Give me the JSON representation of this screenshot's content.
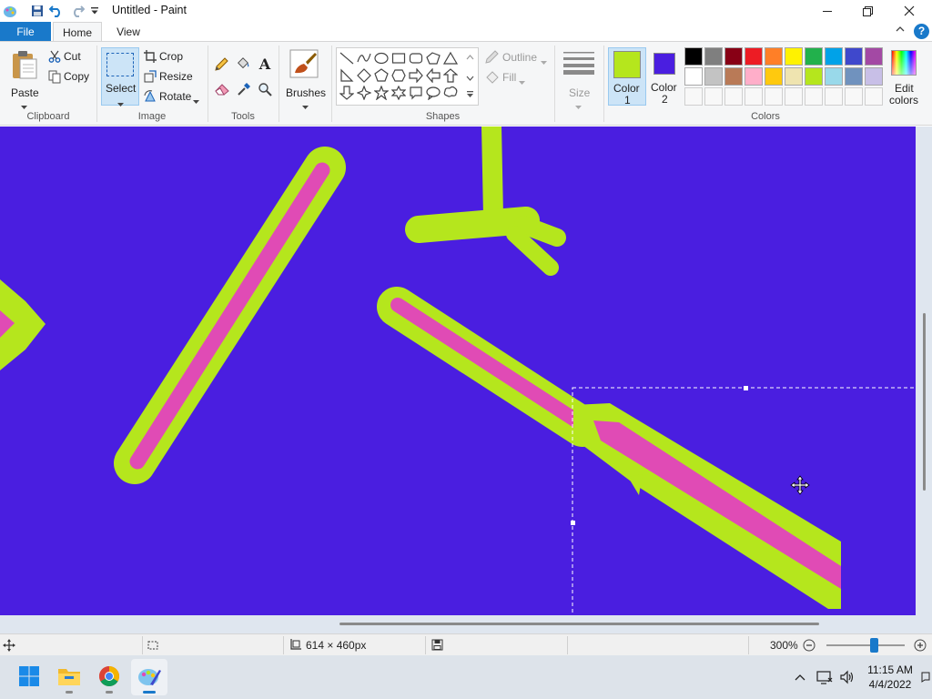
{
  "window": {
    "title": "Untitled - Paint",
    "qat": [
      "save-icon",
      "undo-icon",
      "redo-icon",
      "customize-qat-icon"
    ],
    "controls": [
      "minimize",
      "maximize",
      "close"
    ]
  },
  "tabs": {
    "file": "File",
    "home": "Home",
    "view": "View",
    "help": "?"
  },
  "ribbon": {
    "clipboard": {
      "paste": "Paste",
      "cut": "Cut",
      "copy": "Copy",
      "label": "Clipboard"
    },
    "image": {
      "select": "Select",
      "crop": "Crop",
      "resize": "Resize",
      "rotate": "Rotate",
      "label": "Image"
    },
    "tools": {
      "label": "Tools",
      "icons": [
        "pencil-icon",
        "fill-icon",
        "text-icon",
        "eraser-icon",
        "color-picker-icon",
        "magnifier-icon"
      ]
    },
    "brushes": {
      "label": "Brushes"
    },
    "shapes": {
      "outline": "Outline",
      "fill": "Fill",
      "label": "Shapes"
    },
    "size": {
      "label": "Size"
    },
    "colors": {
      "color1": {
        "line1": "Color",
        "line2": "1",
        "value": "#b5e61d"
      },
      "color2": {
        "line1": "Color",
        "line2": "2",
        "value": "#4a1ee0"
      },
      "edit_line1": "Edit",
      "edit_line2": "colors",
      "label": "Colors",
      "palette_row1": [
        "#000000",
        "#7f7f7f",
        "#880015",
        "#ed1c24",
        "#ff7f27",
        "#fff200",
        "#22b14c",
        "#00a2e8",
        "#3f48cc",
        "#a349a4"
      ],
      "palette_row2": [
        "#ffffff",
        "#c3c3c3",
        "#b97a57",
        "#ffaec9",
        "#ffc90e",
        "#efe4b0",
        "#b5e61d",
        "#99d9ea",
        "#7092be",
        "#c8bfe7"
      ]
    }
  },
  "canvas": {
    "background": "#4a1ee0",
    "stroke_outer": "#b5e61d",
    "stroke_inner": "#e04bb5"
  },
  "status": {
    "canvas_size": "614 × 460px",
    "zoom": "300%"
  },
  "taskbar": {
    "apps": [
      "start-icon",
      "file-explorer-icon",
      "chrome-icon",
      "paint-icon"
    ],
    "time": "11:15 AM",
    "date": "4/4/2022"
  }
}
